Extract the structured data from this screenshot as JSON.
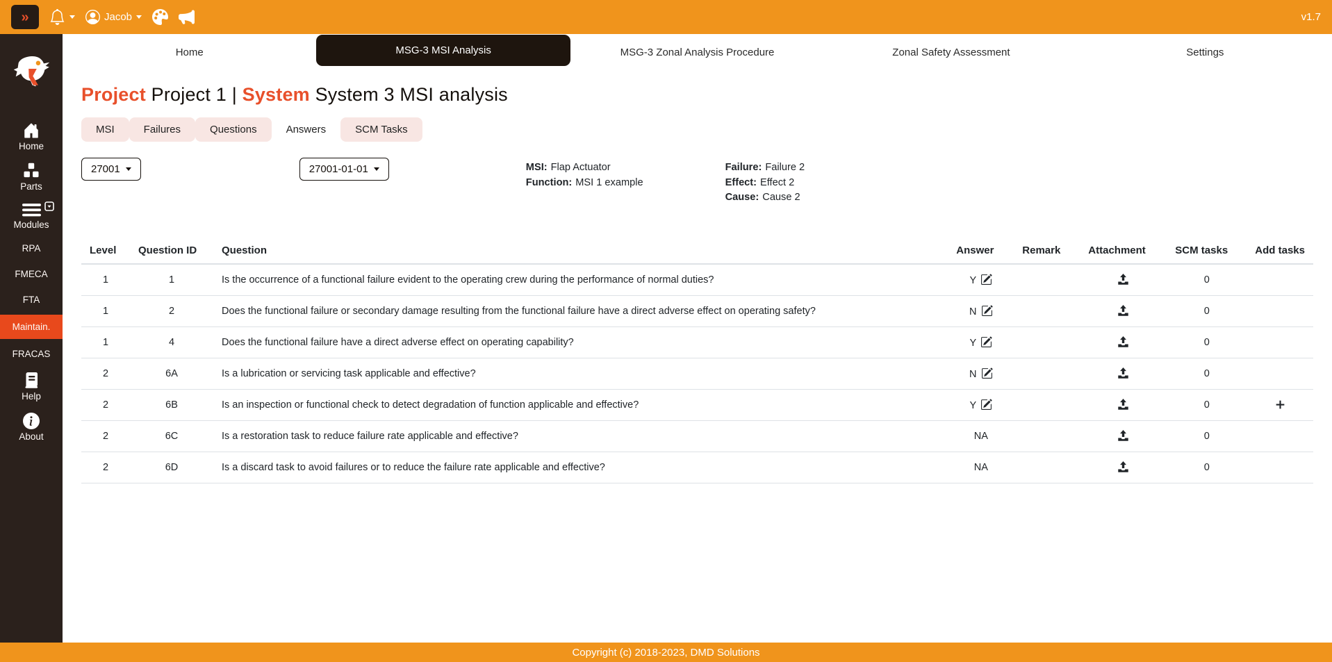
{
  "topbar": {
    "expand_label": "»",
    "user_name": "Jacob",
    "version": "v1.7",
    "icons": [
      "bell-icon",
      "person-circle-icon",
      "palette-icon",
      "megaphone-icon"
    ]
  },
  "nav": {
    "tabs": [
      {
        "label": "Home",
        "active": false
      },
      {
        "label": "MSG-3 MSI Analysis",
        "active": true
      },
      {
        "label": "MSG-3 Zonal Analysis Procedure",
        "active": false
      },
      {
        "label": "Zonal Safety Assessment",
        "active": false
      },
      {
        "label": "Settings",
        "active": false
      }
    ]
  },
  "sidebar": {
    "items": [
      {
        "label": "Home",
        "icon": "home-icon"
      },
      {
        "label": "Parts",
        "icon": "parts-icon"
      },
      {
        "label": "Modules",
        "icon": "modules-icon"
      },
      {
        "label": "RPA"
      },
      {
        "label": "FMECA"
      },
      {
        "label": "FTA"
      },
      {
        "label": "Maintain.",
        "active": true
      },
      {
        "label": "FRACAS"
      },
      {
        "label": "Help",
        "icon": "help-icon"
      },
      {
        "label": "About",
        "icon": "about-icon"
      }
    ]
  },
  "page": {
    "project_label": "Project",
    "project_name": "Project 1",
    "separator": "|",
    "system_label": "System",
    "system_name": "System 3 MSI analysis"
  },
  "content_tabs": [
    {
      "label": "MSI",
      "active": false
    },
    {
      "label": "Failures",
      "active": false
    },
    {
      "label": "Questions",
      "active": false
    },
    {
      "label": "Answers",
      "active": true
    },
    {
      "label": "SCM Tasks",
      "active": false
    }
  ],
  "filters": {
    "msi_select_value": "27001",
    "failure_select_value": "27001-01-01"
  },
  "details": {
    "msi": {
      "label": "MSI:",
      "value": "Flap Actuator"
    },
    "function": {
      "label": "Function:",
      "value": "MSI 1 example"
    },
    "failure": {
      "label": "Failure:",
      "value": "Failure 2"
    },
    "effect": {
      "label": "Effect:",
      "value": "Effect 2"
    },
    "cause": {
      "label": "Cause:",
      "value": "Cause 2"
    }
  },
  "table": {
    "headers": [
      "Level",
      "Question ID",
      "Question",
      "Answer",
      "Remark",
      "Attachment",
      "SCM tasks",
      "Add tasks"
    ],
    "rows": [
      {
        "level": "1",
        "question_id": "1",
        "question": "Is the occurrence of a functional failure evident to the operating crew during the performance of normal duties?",
        "answer": "Y",
        "answer_icon": "edit-icon",
        "remark": "",
        "attachment_icon": "upload-icon",
        "scm_tasks": "0",
        "add_task_icon": ""
      },
      {
        "level": "1",
        "question_id": "2",
        "question": "Does the functional failure or secondary damage resulting from the functional failure have a direct adverse effect on operating safety?",
        "answer": "N",
        "answer_icon": "edit-icon",
        "remark": "",
        "attachment_icon": "upload-icon",
        "scm_tasks": "0",
        "add_task_icon": ""
      },
      {
        "level": "1",
        "question_id": "4",
        "question": "Does the functional failure have a direct adverse effect on operating capability?",
        "answer": "Y",
        "answer_icon": "edit-icon",
        "remark": "",
        "attachment_icon": "upload-icon",
        "scm_tasks": "0",
        "add_task_icon": ""
      },
      {
        "level": "2",
        "question_id": "6A",
        "question": "Is a lubrication or servicing task applicable and effective?",
        "answer": "N",
        "answer_icon": "edit-icon",
        "remark": "",
        "attachment_icon": "upload-icon",
        "scm_tasks": "0",
        "add_task_icon": ""
      },
      {
        "level": "2",
        "question_id": "6B",
        "question": "Is an inspection or functional check to detect degradation of function applicable and effective?",
        "answer": "Y",
        "answer_icon": "edit-icon",
        "remark": "",
        "attachment_icon": "upload-icon",
        "scm_tasks": "0",
        "add_task_icon": "plus-icon"
      },
      {
        "level": "2",
        "question_id": "6C",
        "question": "Is a restoration task to reduce failure rate applicable and effective?",
        "answer": "NA",
        "answer_icon": "",
        "remark": "",
        "attachment_icon": "upload-icon",
        "scm_tasks": "0",
        "add_task_icon": ""
      },
      {
        "level": "2",
        "question_id": "6D",
        "question": "Is a discard task to avoid failures or to reduce the failure rate applicable and effective?",
        "answer": "NA",
        "answer_icon": "",
        "remark": "",
        "attachment_icon": "upload-icon",
        "scm_tasks": "0",
        "add_task_icon": ""
      }
    ]
  },
  "footer": {
    "copyright": "Copyright (c) 2018-2023, DMD Solutions"
  },
  "colors": {
    "topbar_orange": "#F0941C",
    "accent_red": "#E8502B",
    "sidebar_dark": "#2B211C",
    "active_nav_dark": "#1E150E",
    "active_sidebar_item": "#E8491C",
    "pill_pink": "#F8E6E3",
    "table_border": "#DEE2E6"
  }
}
